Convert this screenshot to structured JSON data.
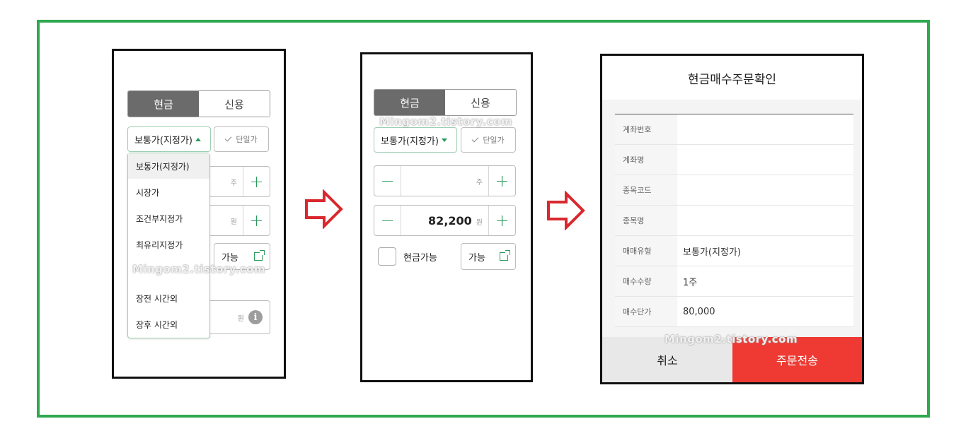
{
  "screen1": {
    "tabs": [
      "현금",
      "신용"
    ],
    "order_type": "보통가(지정가)",
    "unit_price_btn": "단일가",
    "dropdown_items": [
      "보통가(지정가)",
      "시장가",
      "조건부지정가",
      "최유리지정가",
      "장전 시간외",
      "장후 시간외"
    ],
    "qty_unit": "주",
    "price_unit": "원",
    "available_btn": "가능",
    "amount_unit": "원",
    "watermark": "Mingom2.tistory.com"
  },
  "screen2": {
    "tabs": [
      "현금",
      "신용"
    ],
    "order_type": "보통가(지정가)",
    "unit_price_btn": "단일가",
    "qty_unit": "주",
    "price_value": "82,200",
    "price_unit": "원",
    "cash_available_label": "현금가능",
    "available_btn": "가능",
    "watermark": "Mingom2.tistory.com"
  },
  "screen3": {
    "title": "현금매수주문확인",
    "rows": [
      {
        "label": "계좌번호",
        "value": ""
      },
      {
        "label": "계좌명",
        "value": ""
      },
      {
        "label": "종목코드",
        "value": ""
      },
      {
        "label": "종목명",
        "value": ""
      },
      {
        "label": "매매유형",
        "value": "보통가(지정가)"
      },
      {
        "label": "매수수량",
        "value": "1주"
      },
      {
        "label": "매수단가",
        "value": "80,000"
      }
    ],
    "cancel_label": "취소",
    "submit_label": "주문전송",
    "watermark": "Mingom2.tistory.com"
  },
  "colors": {
    "frame": "#2fa84f",
    "accent_green": "#2a9a5b",
    "submit_red": "#ee3a33",
    "arrow_red": "#d9282f",
    "tab_active": "#6b6b6b"
  },
  "icons": [
    "arrow-right-icon",
    "plus-icon",
    "minus-icon",
    "check-icon",
    "external-link-icon",
    "info-icon",
    "caret-up-icon",
    "caret-down-icon"
  ]
}
